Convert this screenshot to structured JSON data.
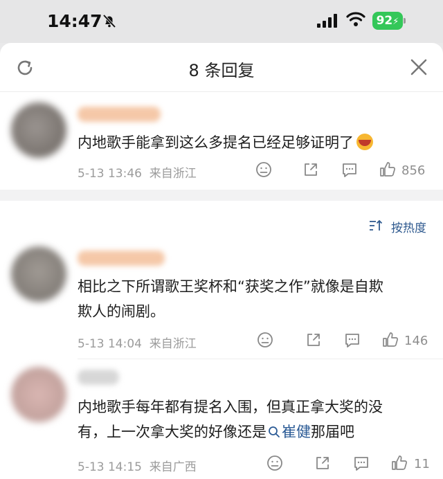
{
  "status_bar": {
    "time": "14:47",
    "battery": "92"
  },
  "sheet": {
    "title": "8 条回复"
  },
  "top_comment": {
    "text": "内地歌手能拿到这么多提名已经足够证明了",
    "time": "5-13 13:46",
    "location": "来自浙江",
    "likes": "856"
  },
  "sort_label": "按热度",
  "replies": [
    {
      "text_line1": "相比之下所谓歌王奖杯和“获奖之作”就像是自欺",
      "text_line2": "欺人的闹剧。",
      "time": "5-13 14:04",
      "location": "来自浙江",
      "likes": "146"
    },
    {
      "text_line1": "内地歌手每年都有提名入围，但真正拿大奖的没",
      "text_line2_pre": "有，上一次拿大奖的好像还是",
      "text_line2_link": "崔健",
      "text_line2_post": "那届吧",
      "time": "5-13 14:15",
      "location": "来自广西",
      "likes": "11"
    }
  ],
  "colors": {
    "accent": "#2f5a8f",
    "battery": "#34c759"
  }
}
